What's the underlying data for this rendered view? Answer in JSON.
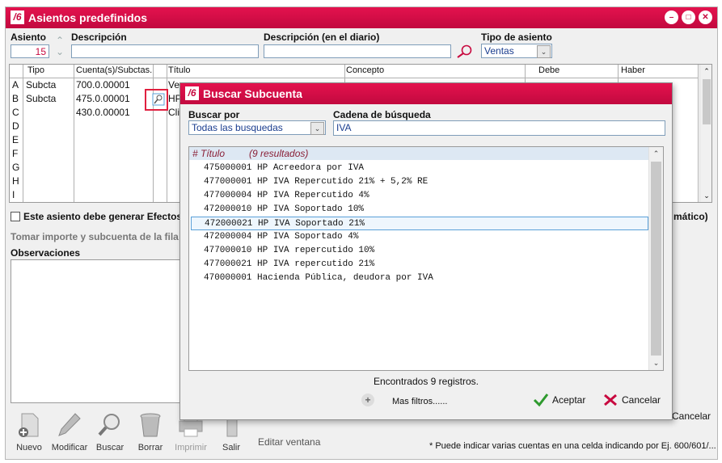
{
  "window": {
    "title": "Asientos predefinidos"
  },
  "header": {
    "asiento_label": "Asiento",
    "asiento_value": "15",
    "descripcion_label": "Descripción",
    "descripcion_value": "",
    "descripcion_diario_label": "Descripción (en el diario)",
    "descripcion_diario_value": "",
    "tipo_label": "Tipo de asiento",
    "tipo_value": "Ventas"
  },
  "grid": {
    "columns": [
      "Tipo",
      "Cuenta(s)/Subctas.",
      "Título",
      "Concepto",
      "Debe",
      "Haber"
    ],
    "row_letters": [
      "A",
      "B",
      "C",
      "D",
      "E",
      "F",
      "G",
      "H",
      "I"
    ],
    "rows": [
      {
        "tipo": "Subcta",
        "cuenta": "700.0.00001",
        "titulo": "Ven"
      },
      {
        "tipo": "Subcta",
        "cuenta": "475.0.00001",
        "titulo": "HP"
      },
      {
        "tipo": "",
        "cuenta": "430.0.00001",
        "titulo": "Cli"
      }
    ]
  },
  "options": {
    "efectos_label": "Este asiento debe generar Efectos",
    "automatico_suffix": "mático)",
    "tomar_importe": "Tomar importe y subcuenta de la fila",
    "observaciones_label": "Observaciones",
    "observaciones_value": ""
  },
  "toolbar": {
    "nuevo": "Nuevo",
    "modificar": "Modificar",
    "buscar": "Buscar",
    "borrar": "Borrar",
    "imprimir": "Imprimir",
    "salir": "Salir",
    "editar_ventana": "Editar ventana",
    "cancelar_bg": "Cancelar",
    "footer_note": "* Puede indicar varias cuentas en una celda indicando por Ej. 600/601/..."
  },
  "dialog": {
    "title": "Buscar Subcuenta",
    "buscar_por_label": "Buscar por",
    "buscar_por_value": "Todas las busquedas",
    "cadena_label": "Cadena de búsqueda",
    "cadena_value": "IVA",
    "results_header_title": "# Título",
    "results_header_count": "(9 resultados)",
    "results": [
      "475000001 HP Acreedora por IVA",
      "477000001 HP IVA Repercutido 21% + 5,2% RE",
      "477000004 HP IVA Repercutido 4%",
      "472000010 HP IVA Soportado 10%",
      "472000021 HP IVA Soportado 21%",
      "472000004 HP IVA Soportado 4%",
      "477000010 HP IVA repercutido 10%",
      "477000021 HP IVA repercutido 21%",
      "470000001 Hacienda Pública, deudora por IVA"
    ],
    "selected_index": 4,
    "found_text": "Encontrados 9 registros.",
    "mas_filtros": "Mas filtros......",
    "aceptar": "Aceptar",
    "cancelar": "Cancelar"
  },
  "colors": {
    "brand": "#d40d48",
    "selection_border": "#5aa0d8"
  }
}
